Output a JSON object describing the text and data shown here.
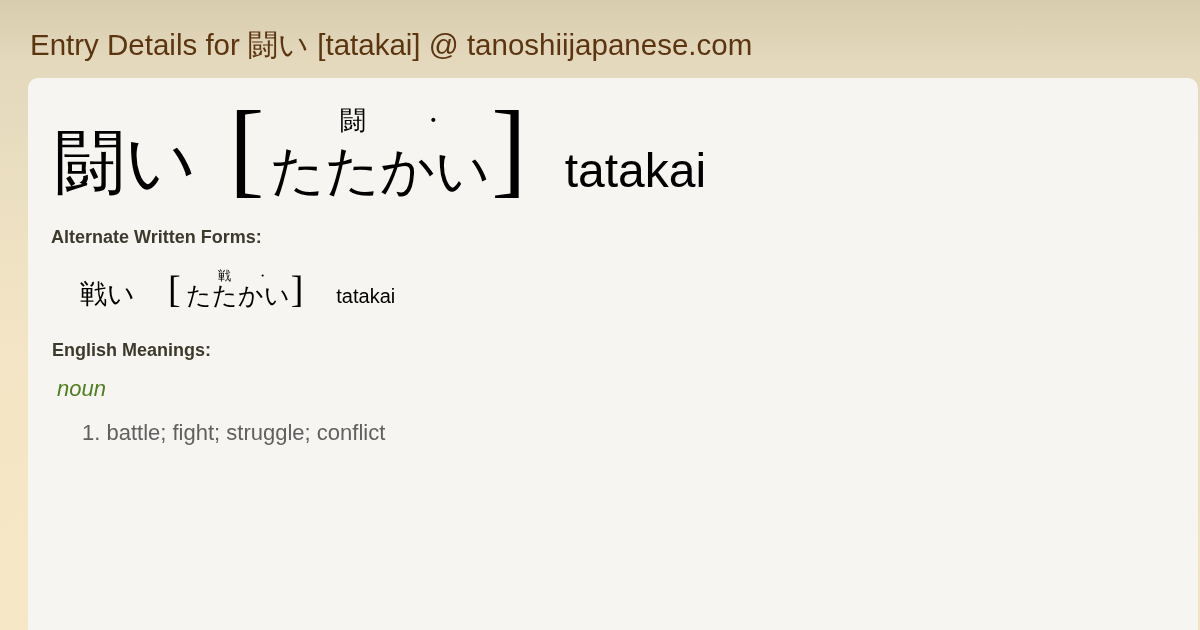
{
  "page_title": "Entry Details for 闘い [tatakai] @ tanoshiijapanese.com",
  "entry": {
    "written": "闘い",
    "open_bracket": "[",
    "reading": [
      {
        "kana": "たたか",
        "mark": {
          "kind": "kanji",
          "text": "闘"
        }
      },
      {
        "kana": "い",
        "mark": {
          "kind": "dot",
          "text": "・"
        }
      }
    ],
    "close_bracket": "]",
    "romaji": "tatakai"
  },
  "alternate_written_forms": {
    "heading": "Alternate Written Forms:",
    "items": [
      {
        "written": "戦い",
        "open_bracket": "[",
        "reading": [
          {
            "kana": "たたか",
            "mark": {
              "kind": "kanji",
              "text": "戦"
            }
          },
          {
            "kana": "い",
            "mark": {
              "kind": "dot",
              "text": "・"
            }
          }
        ],
        "close_bracket": "]",
        "romaji": "tatakai"
      }
    ]
  },
  "english_meanings": {
    "heading": "English Meanings:",
    "groups": [
      {
        "part_of_speech": "noun",
        "senses": [
          "1. battle; fight; struggle; conflict"
        ]
      }
    ]
  }
}
